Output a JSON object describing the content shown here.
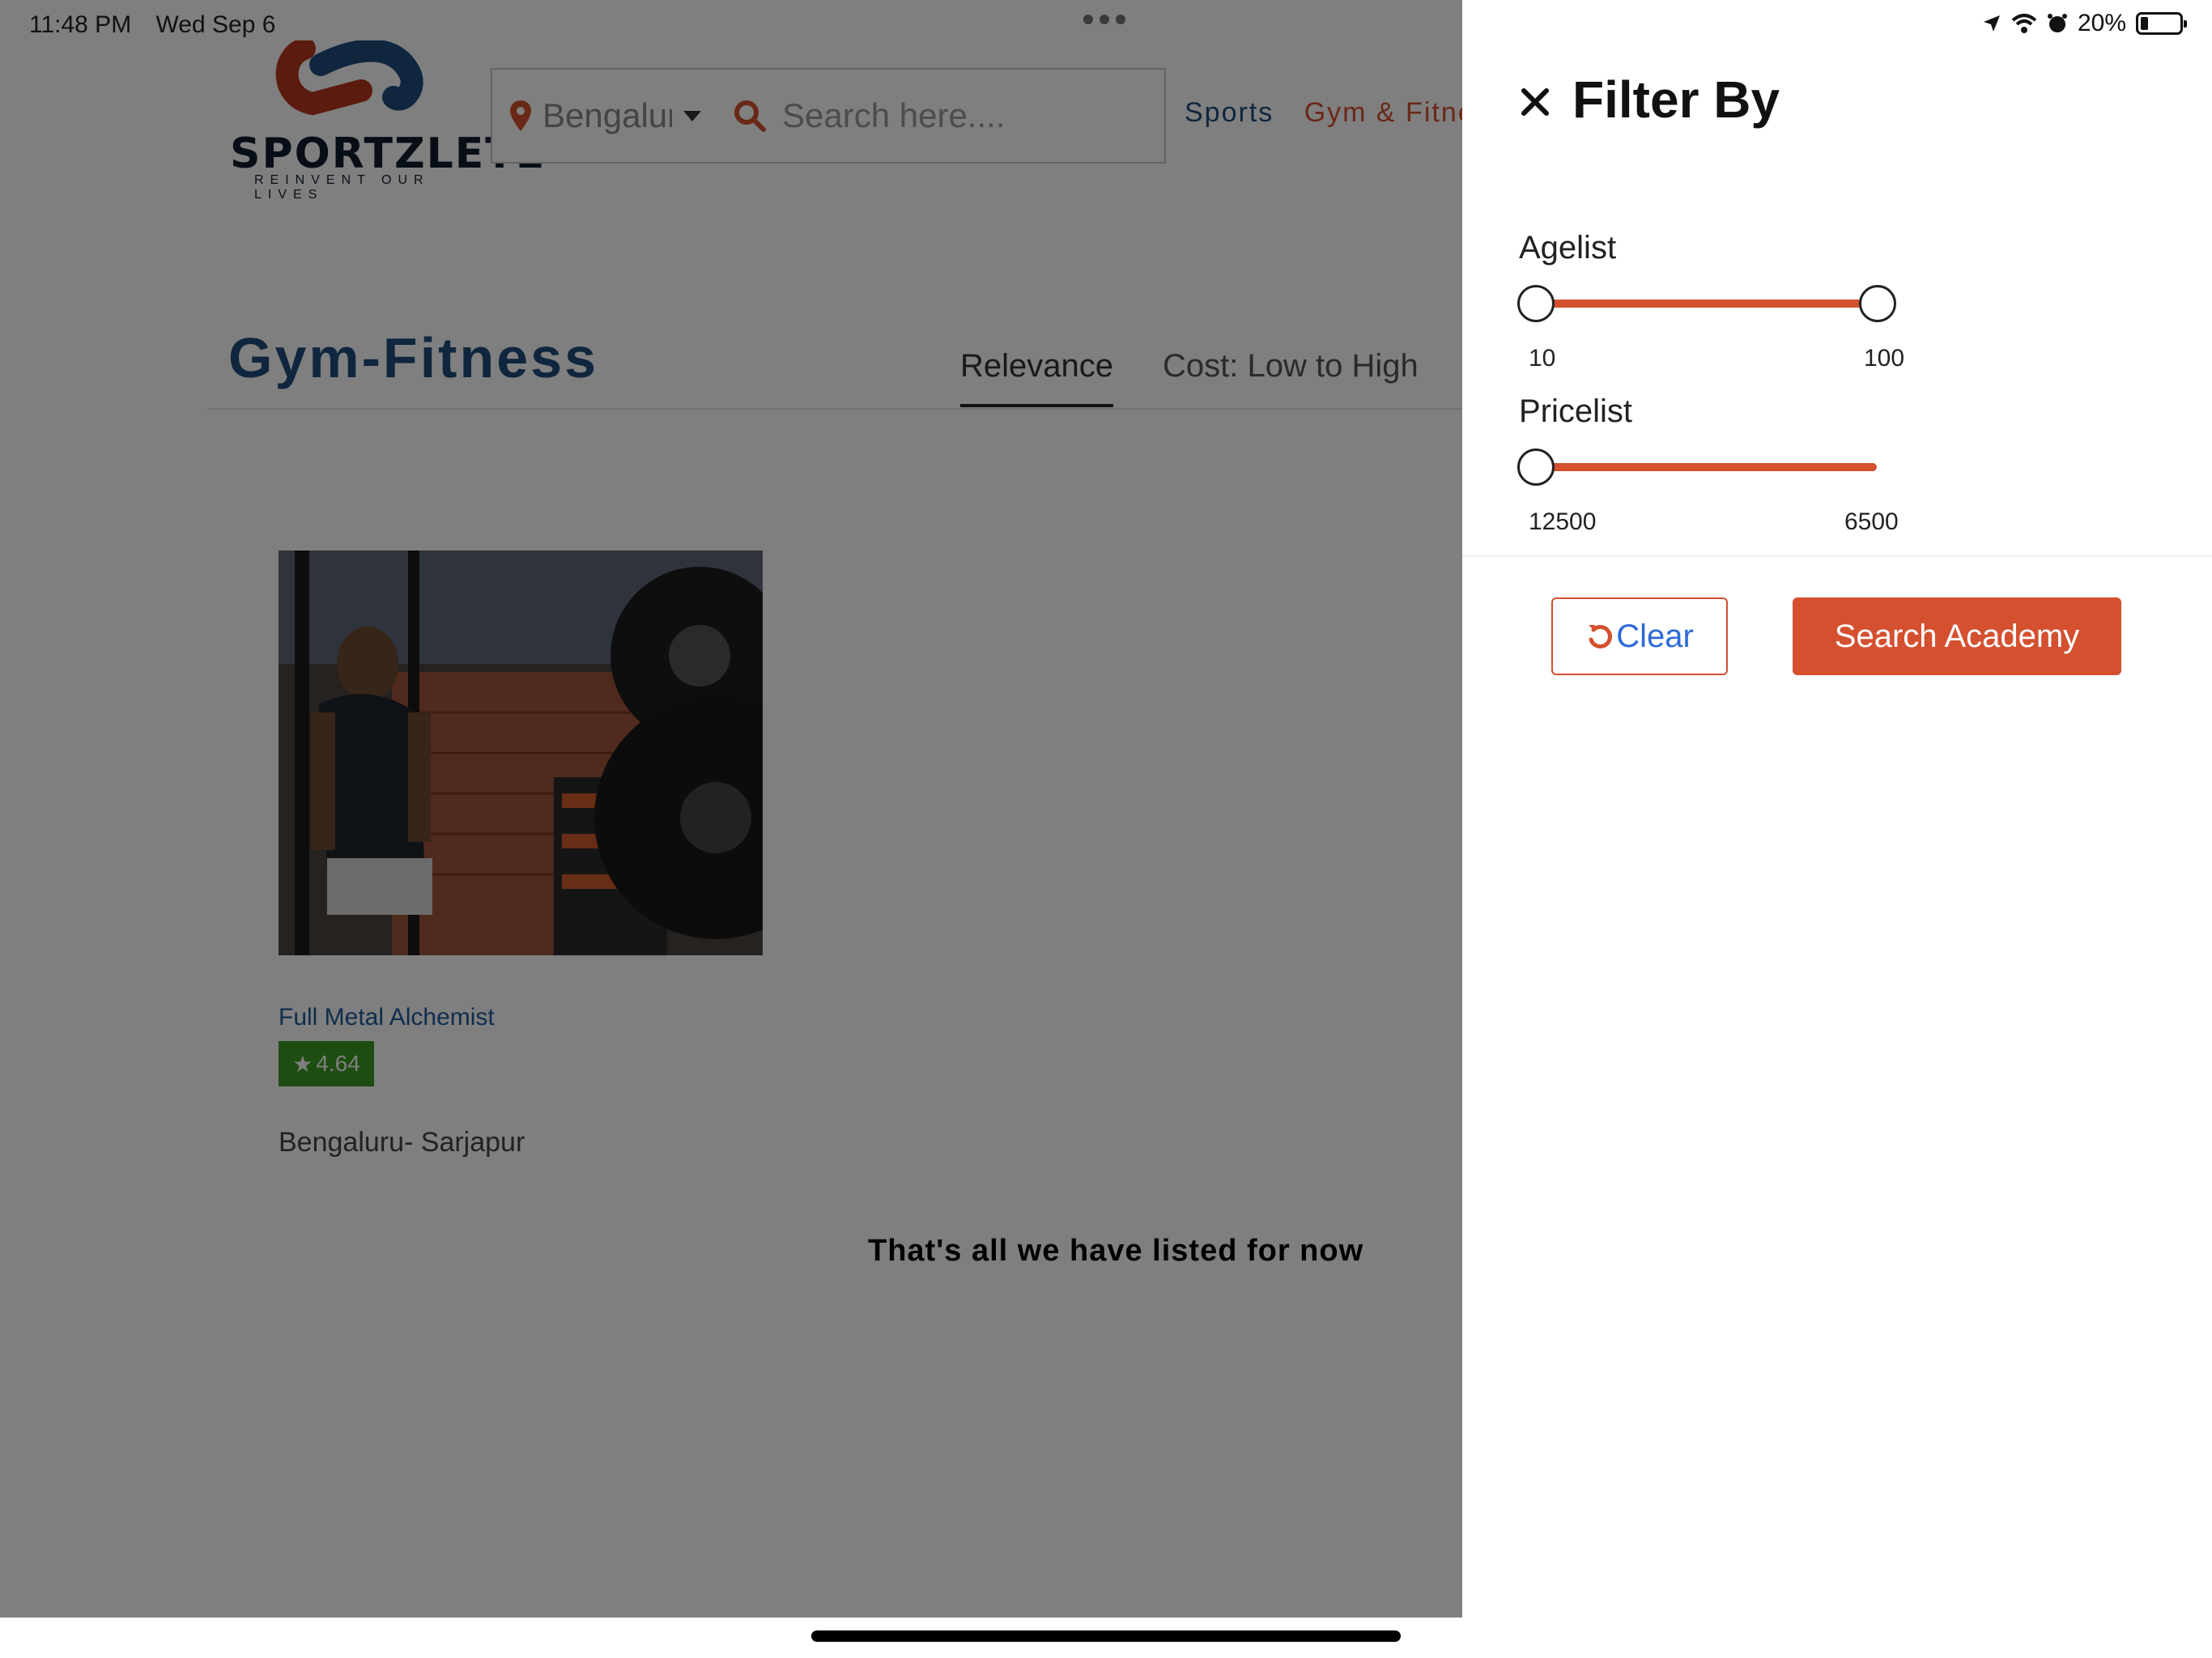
{
  "status_bar": {
    "time": "11:48 PM",
    "date": "Wed Sep 6",
    "battery": "20%",
    "icons": [
      "location-arrow-icon",
      "wifi-icon",
      "alarm-icon",
      "battery-icon"
    ]
  },
  "header": {
    "logo_text": "SPORTZLETE",
    "logo_tagline": "REINVENT OUR LIVES",
    "location_value": "Bengaluru",
    "search_placeholder": "Search here....",
    "nav": {
      "sports": "Sports",
      "gym": "Gym & Fitness"
    }
  },
  "main": {
    "title": "Gym-Fitness",
    "sort_tabs": [
      {
        "label": "Relevance",
        "active": true
      },
      {
        "label": "Cost: Low to High",
        "active": false
      }
    ],
    "listings": [
      {
        "name": "Full Metal Alchemist",
        "rating": "4.64",
        "location": "Bengaluru- Sarjapur"
      }
    ],
    "end_message": "That's all we have listed for now"
  },
  "filter": {
    "title": "Filter By",
    "age": {
      "label": "Agelist",
      "min_label": "10",
      "max_label": "100",
      "min_value": 10,
      "max_value": 100
    },
    "price": {
      "label": "Pricelist",
      "min_label": "12500",
      "max_label": "6500",
      "value": 12500
    },
    "clear_label": "Clear",
    "search_label": "Search Academy"
  },
  "colors": {
    "accent": "#d4502f",
    "brand_blue": "#1f4d7d",
    "rating_green": "#3a9b22",
    "link_blue": "#2d6ad8"
  }
}
